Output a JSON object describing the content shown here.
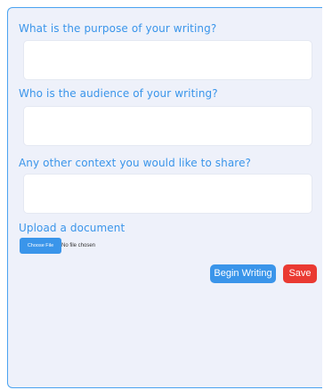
{
  "questions": {
    "purpose_label": "What is the purpose of your writing?",
    "audience_label": "Who is the audience of your writing?",
    "context_label": "Any other context you would like to share?"
  },
  "upload": {
    "label": "Upload a document",
    "button_label": "Choose File",
    "status": "No file chosen"
  },
  "actions": {
    "begin_label": "Begin Writing",
    "save_label": "Save"
  },
  "colors": {
    "accent": "#3a95ea",
    "danger": "#ea3a32",
    "panel_background": "#eef1fa"
  }
}
